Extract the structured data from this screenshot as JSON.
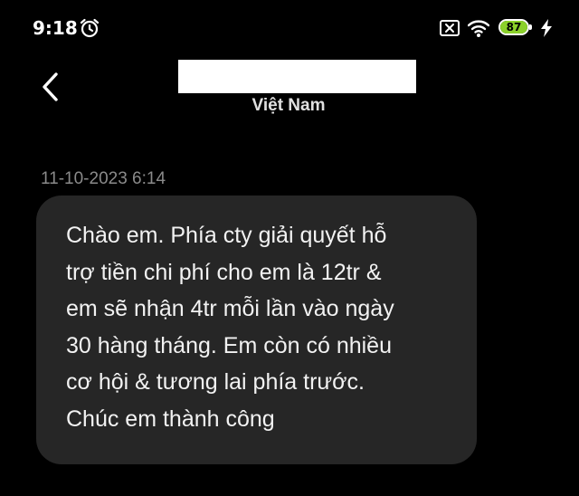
{
  "status_bar": {
    "time": "9:18",
    "battery_level": "87",
    "icons": [
      "alarm-icon",
      "sim-off-icon",
      "wifi-icon",
      "battery-icon",
      "charging-icon"
    ],
    "battery_color": "#8bd12a"
  },
  "header": {
    "back_icon": "chevron-left-icon",
    "contact_name": "",
    "subtitle": "Việt Nam"
  },
  "conversation": {
    "messages": [
      {
        "timestamp": "11-10-2023 6:14",
        "text": "Chào em. Phía cty giải quyết hỗ\ntrợ tiền chi phí cho em là 12tr &\nem sẽ nhận 4tr mỗi lần vào ngày\n30 hàng tháng. Em còn có nhiều\ncơ hội & tương lai phía trước.\nChúc em thành công",
        "bubble_color": "#262626"
      }
    ]
  }
}
